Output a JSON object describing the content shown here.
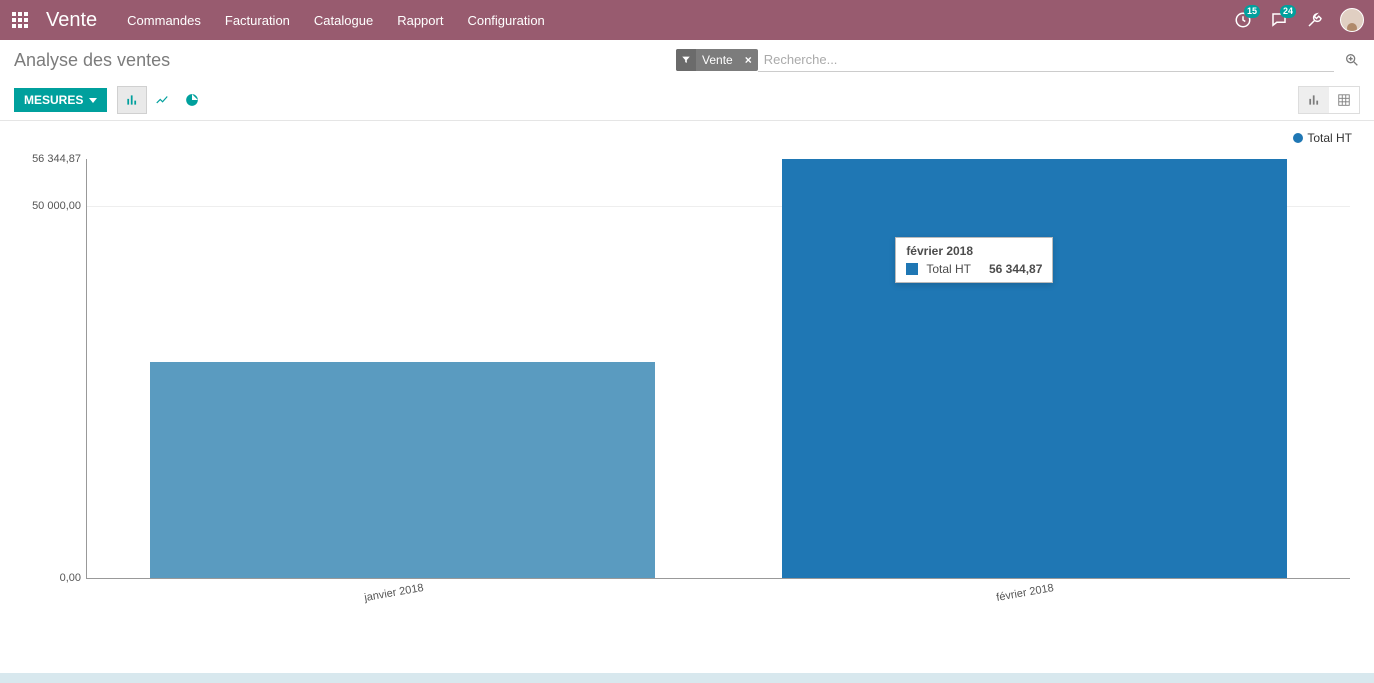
{
  "navbar": {
    "brand": "Vente",
    "menu": [
      "Commandes",
      "Facturation",
      "Catalogue",
      "Rapport",
      "Configuration"
    ],
    "messages_badge": "15",
    "chat_badge": "24"
  },
  "breadcrumb": "Analyse des ventes",
  "search": {
    "facet_label": "Vente",
    "placeholder": "Recherche..."
  },
  "toolbar": {
    "measures_label": "MESURES"
  },
  "legend": {
    "label": "Total HT"
  },
  "yticks": [
    "0,00",
    "50 000,00",
    "56 344,87"
  ],
  "tooltip": {
    "title": "février 2018",
    "series_label": "Total HT",
    "value": "56 344,87"
  },
  "chart_data": {
    "type": "bar",
    "categories": [
      "janvier 2018",
      "février 2018"
    ],
    "series": [
      {
        "name": "Total HT",
        "values": [
          29000,
          56344.87
        ]
      }
    ],
    "title": "",
    "xlabel": "",
    "ylabel": "",
    "ylim": [
      0,
      56344.87
    ]
  }
}
